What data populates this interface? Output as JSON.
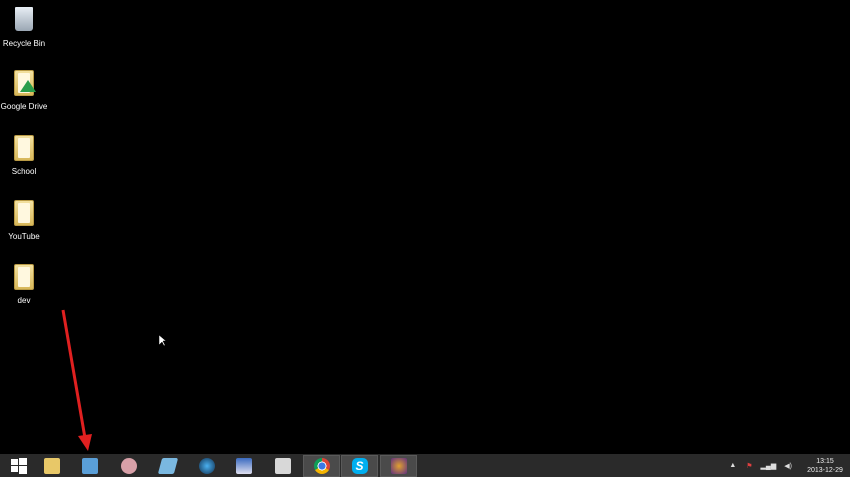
{
  "desktop_icons": [
    {
      "label": "Recycle Bin",
      "icon": "recycle-bin-icon"
    },
    {
      "label": "Google Drive",
      "icon": "google-drive-folder-icon"
    },
    {
      "label": "School",
      "icon": "folder-icon"
    },
    {
      "label": "YouTube",
      "icon": "folder-icon"
    },
    {
      "label": "dev",
      "icon": "folder-icon"
    }
  ],
  "taskbar": {
    "items": [
      "start-icon",
      "file-explorer-icon",
      "remote-desktop-icon",
      "snipping-tool-icon",
      "notepad-icon",
      "media-player-icon",
      "paint-icon",
      "video-capture-icon",
      "chrome-icon",
      "skype-icon",
      "game-icon"
    ]
  },
  "tray": {
    "time": "13:15",
    "date": "2013-12-29"
  },
  "colors": {
    "taskbar": "#2a2a2a",
    "annotation_arrow": "#e02020"
  }
}
